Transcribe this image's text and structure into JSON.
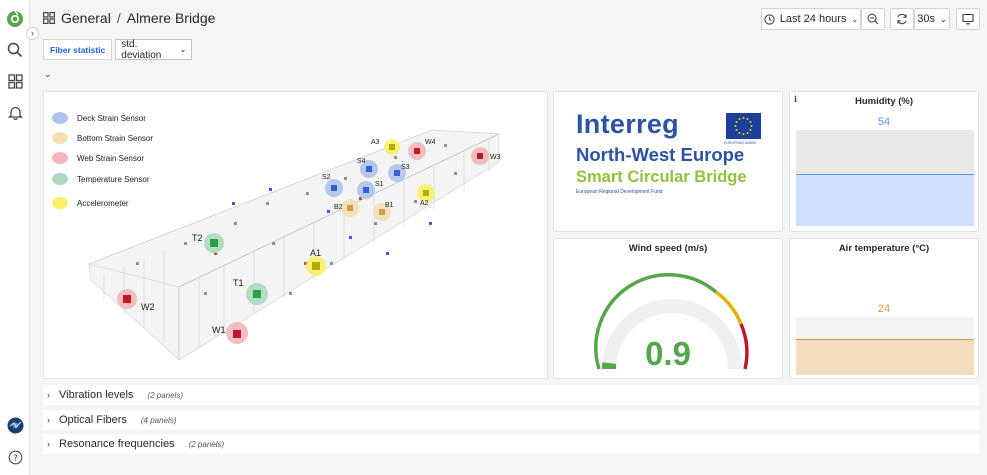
{
  "breadcrumb": {
    "folder": "General",
    "separator": "/",
    "dashboard": "Almere Bridge"
  },
  "toolbar": {
    "time_range": "Last 24 hours",
    "refresh_interval": "30s"
  },
  "variables": {
    "label": "Fiber statistic",
    "selected": "std. deviation"
  },
  "panels": {
    "bridge": {
      "legend": [
        "Deck Strain Sensor",
        "Bottom Strain Sensor",
        "Web Strain Sensor",
        "Temperature Sensor",
        "Accelerometer"
      ],
      "legend_colors": [
        "#aec4ea",
        "#f3dfb1",
        "#f3b8bc",
        "#a9dcbd",
        "#f7f16a"
      ],
      "labels": [
        "A3",
        "W4",
        "W3",
        "S4",
        "S3",
        "S2",
        "S1",
        "A2",
        "B2",
        "B1",
        "T2",
        "A1",
        "T1",
        "W2",
        "W1"
      ]
    },
    "logo": {
      "brand": "Interreg",
      "region": "North-West Europe",
      "project": "Smart Circular Bridge",
      "eu_label": "EUROPEAN UNION",
      "fund": "European Regional Development Fund"
    },
    "humidity": {
      "title": "Humidity (%)",
      "value": "54",
      "fill_percent": 54
    },
    "wind": {
      "title": "Wind speed (m/s)",
      "value": "0.9",
      "gauge_fraction": 0.03
    },
    "air_temp": {
      "title": "Air temperature (°C)",
      "value": "24",
      "fill_percent": 62
    }
  },
  "rows": [
    {
      "title": "Vibration levels",
      "count": "(2 panels)"
    },
    {
      "title": "Optical Fibers",
      "count": "(4 panels)"
    },
    {
      "title": "Resonance frequencies",
      "count": "(2 panels)"
    }
  ],
  "colors": {
    "accent": "#1f62e0",
    "humidity": "#5794f2",
    "temperature": "#d39b4a",
    "gauge_green": "#56a64b",
    "gauge_yellow": "#e0b400",
    "gauge_red": "#c4162a"
  }
}
